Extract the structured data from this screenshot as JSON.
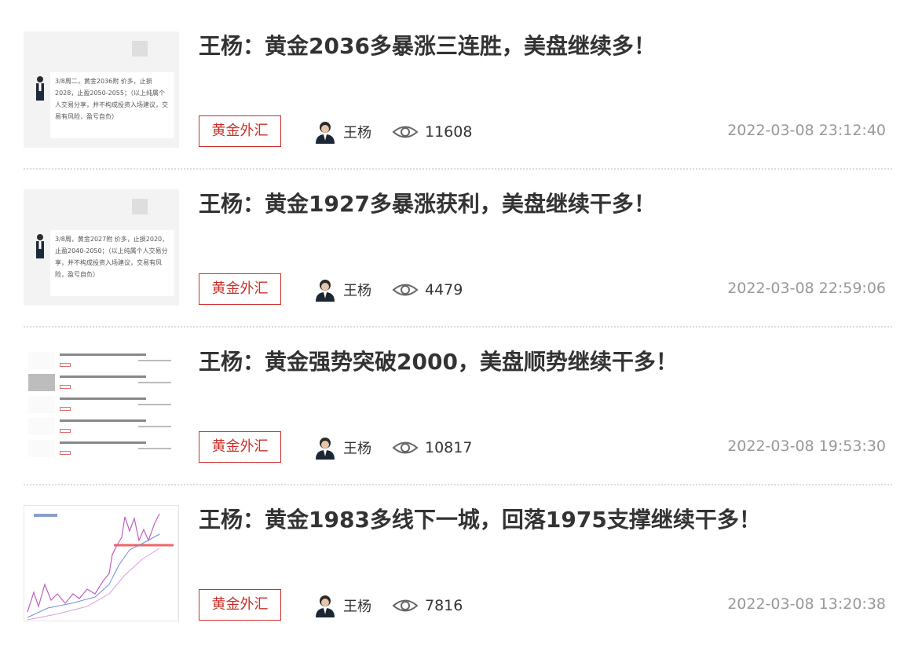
{
  "articles": [
    {
      "title": "王杨：黄金2036多暴涨三连胜，美盘继续多！",
      "tag": "黄金外汇",
      "author": "王杨",
      "views": "11608",
      "time": "2022-03-08 23:12:40",
      "thumb_text": "3/8周二，黄金2036附 价多，止损2028，止盈2050-2055；（以上纯属个人交易分享，并不构成投资入场建议，交易有风险，盈亏自负）"
    },
    {
      "title": "王杨：黄金1927多暴涨获利，美盘继续干多！",
      "tag": "黄金外汇",
      "author": "王杨",
      "views": "4479",
      "time": "2022-03-08 22:59:06",
      "thumb_text": "3/8周，黄金2027附 价多，止损2020，止盈2040-2050；（以上纯属个人交易分享，并不构成投资入场建议，交易有风险，盈亏自负）"
    },
    {
      "title": "王杨：黄金强势突破2000，美盘顺势继续干多！",
      "tag": "黄金外汇",
      "author": "王杨",
      "views": "10817",
      "time": "2022-03-08 19:53:30"
    },
    {
      "title": "王杨：黄金1983多线下一城，回落1975支撑继续干多！",
      "tag": "黄金外汇",
      "author": "王杨",
      "views": "7816",
      "time": "2022-03-08 13:20:38"
    }
  ],
  "icons": {
    "avatar": "avatar-icon",
    "views": "eye-icon"
  },
  "colors": {
    "tag": "#c9302c",
    "title": "#333333",
    "time": "#999999"
  }
}
